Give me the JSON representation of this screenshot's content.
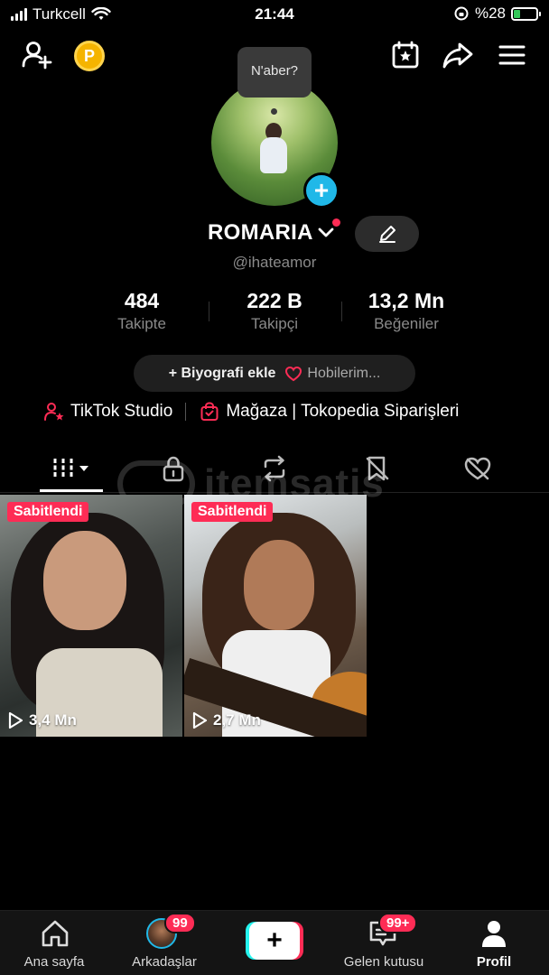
{
  "status_bar": {
    "carrier": "Turkcell",
    "time": "21:44",
    "battery": "%28",
    "battery_level": 0.28
  },
  "top_bar": {
    "left_icons": [
      "add-friend-icon",
      "coin-icon"
    ],
    "coin_label": "P",
    "right_icons": [
      "calendar-star-icon",
      "share-icon",
      "menu-icon"
    ]
  },
  "profile": {
    "note_bubble": "N'aber?",
    "name": "ROMARIA",
    "handle": "@ihateamor",
    "stats": [
      {
        "value": "484",
        "label": "Takipte"
      },
      {
        "value": "222 B",
        "label": "Takipçi"
      },
      {
        "value": "13,2 Mn",
        "label": "Beğeniler"
      }
    ],
    "bio_button": "+ Biyografi ekle",
    "hobbies_button": "Hobilerim...",
    "links": [
      {
        "label": "TikTok Studio",
        "icon": "person-star-icon"
      },
      {
        "label": "Mağaza | Tokopedia Siparişleri",
        "icon": "shopping-bag-icon"
      }
    ]
  },
  "tabs": [
    "videos-grid-icon",
    "lock-icon",
    "repost-icon",
    "saved-icon",
    "liked-icon"
  ],
  "watermark": "itemsatis",
  "videos": [
    {
      "badge": "Sabitlendi",
      "views": "3,4 Mn"
    },
    {
      "badge": "Sabitlendi",
      "views": "2,7 Mn"
    }
  ],
  "bottom_nav": {
    "home": "Ana sayfa",
    "friends": "Arkadaşlar",
    "friends_badge": "99",
    "inbox": "Gelen kutusu",
    "inbox_badge": "99+",
    "profile": "Profil"
  },
  "colors": {
    "accent_red": "#fe2c55",
    "accent_cyan": "#25f4ee",
    "add_blue": "#20b8e8",
    "coin_gold": "#f5b400"
  }
}
